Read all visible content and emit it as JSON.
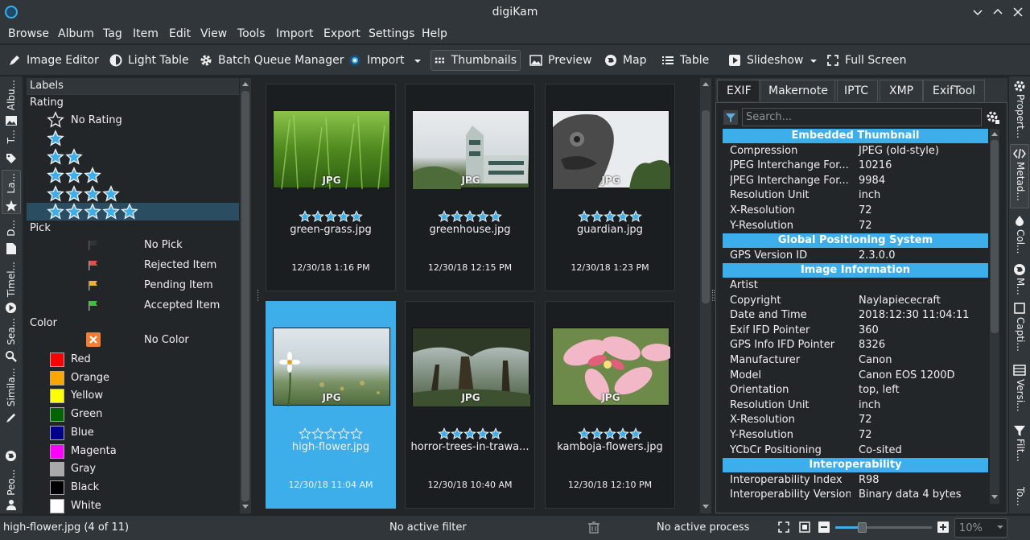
{
  "window": {
    "title": "digiKam"
  },
  "menu": [
    "Browse",
    "Album",
    "Tag",
    "Item",
    "Edit",
    "View",
    "Tools",
    "Import",
    "Export",
    "Settings",
    "Help"
  ],
  "toolbar": {
    "image_editor": "Image Editor",
    "light_table": "Light Table",
    "batch_queue": "Batch Queue Manager",
    "import": "Import",
    "thumbnails": "Thumbnails",
    "preview": "Preview",
    "map": "Map",
    "table": "Table",
    "slideshow": "Slideshow",
    "full_screen": "Full Screen"
  },
  "left_tabs": [
    "Albu...",
    "T...",
    "La...",
    "D...",
    "Timel...",
    "Sea...",
    "Simila...",
    "Peo..."
  ],
  "labels_panel": {
    "title": "Labels",
    "rating_section": "Rating",
    "no_rating": "No Rating",
    "pick_section": "Pick",
    "picks": [
      "No Pick",
      "Rejected Item",
      "Pending Item",
      "Accepted Item"
    ],
    "color_section": "Color",
    "no_color": "No Color",
    "colors": [
      {
        "name": "Red",
        "hex": "#ff0000"
      },
      {
        "name": "Orange",
        "hex": "#ffa500"
      },
      {
        "name": "Yellow",
        "hex": "#ffff00"
      },
      {
        "name": "Green",
        "hex": "#006400"
      },
      {
        "name": "Blue",
        "hex": "#00008b"
      },
      {
        "name": "Magenta",
        "hex": "#ff00ff"
      },
      {
        "name": "Gray",
        "hex": "#a9a9a9"
      },
      {
        "name": "Black",
        "hex": "#000000"
      },
      {
        "name": "White",
        "hex": "#ffffff"
      }
    ]
  },
  "thumbnails": [
    {
      "name": "green-grass.jpg",
      "date": "12/30/18 1:16 PM",
      "rating": 5,
      "badge": "JPG"
    },
    {
      "name": "greenhouse.jpg",
      "date": "12/30/18 12:15 PM",
      "rating": 5,
      "badge": "JPG"
    },
    {
      "name": "guardian.jpg",
      "date": "12/30/18 1:23 PM",
      "rating": 5,
      "badge": "JPG"
    },
    {
      "name": "high-flower.jpg",
      "date": "12/30/18 11:04 AM",
      "rating": 0,
      "badge": "JPG",
      "selected": true
    },
    {
      "name": "horror-trees-in-trawa...",
      "date": "12/30/18 10:40 AM",
      "rating": 5,
      "badge": "JPG"
    },
    {
      "name": "kamboja-flowers.jpg",
      "date": "12/30/18 12:10 PM",
      "rating": 5,
      "badge": "JPG"
    }
  ],
  "metadata": {
    "tabs": [
      "EXIF",
      "Makernote",
      "IPTC",
      "XMP",
      "ExifTool"
    ],
    "search_placeholder": "Search...",
    "sections": [
      {
        "title": "Embedded Thumbnail",
        "rows": [
          [
            "Compression",
            "JPEG (old-style)"
          ],
          [
            "JPEG Interchange For...",
            "10216"
          ],
          [
            "JPEG Interchange For...",
            "9984"
          ],
          [
            "Resolution Unit",
            "inch"
          ],
          [
            "X-Resolution",
            "72"
          ],
          [
            "Y-Resolution",
            "72"
          ]
        ]
      },
      {
        "title": "Global Positioning System",
        "rows": [
          [
            "GPS Version ID",
            "2.3.0.0"
          ]
        ]
      },
      {
        "title": "Image Information",
        "rows": [
          [
            "Artist",
            ""
          ],
          [
            "Copyright",
            "Naylapiececraft"
          ],
          [
            "Date and Time",
            "2018:12:30 11:04:11"
          ],
          [
            "Exif IFD Pointer",
            "360"
          ],
          [
            "GPS Info IFD Pointer",
            "8326"
          ],
          [
            "Manufacturer",
            "Canon"
          ],
          [
            "Model",
            "Canon EOS 1200D"
          ],
          [
            "Orientation",
            "top, left"
          ],
          [
            "Resolution Unit",
            "inch"
          ],
          [
            "X-Resolution",
            "72"
          ],
          [
            "Y-Resolution",
            "72"
          ],
          [
            "YCbCr Positioning",
            "Co-sited"
          ]
        ]
      },
      {
        "title": "Interoperability",
        "rows": [
          [
            "Interoperability Index",
            "R98"
          ],
          [
            "Interoperability Version",
            "Binary data 4 bytes"
          ]
        ]
      }
    ]
  },
  "right_tabs": [
    "Propert...",
    "Metad...",
    "Col...",
    "M...",
    "Capti...",
    "Versi...",
    "Filt...",
    "To..."
  ],
  "status": {
    "item": "high-flower.jpg (4 of 11)",
    "filter": "No active filter",
    "process": "No active process",
    "zoom": "10%"
  },
  "colors": {
    "accent": "#3daee9",
    "window_bg": "#31363b",
    "view_bg": "#232629"
  }
}
